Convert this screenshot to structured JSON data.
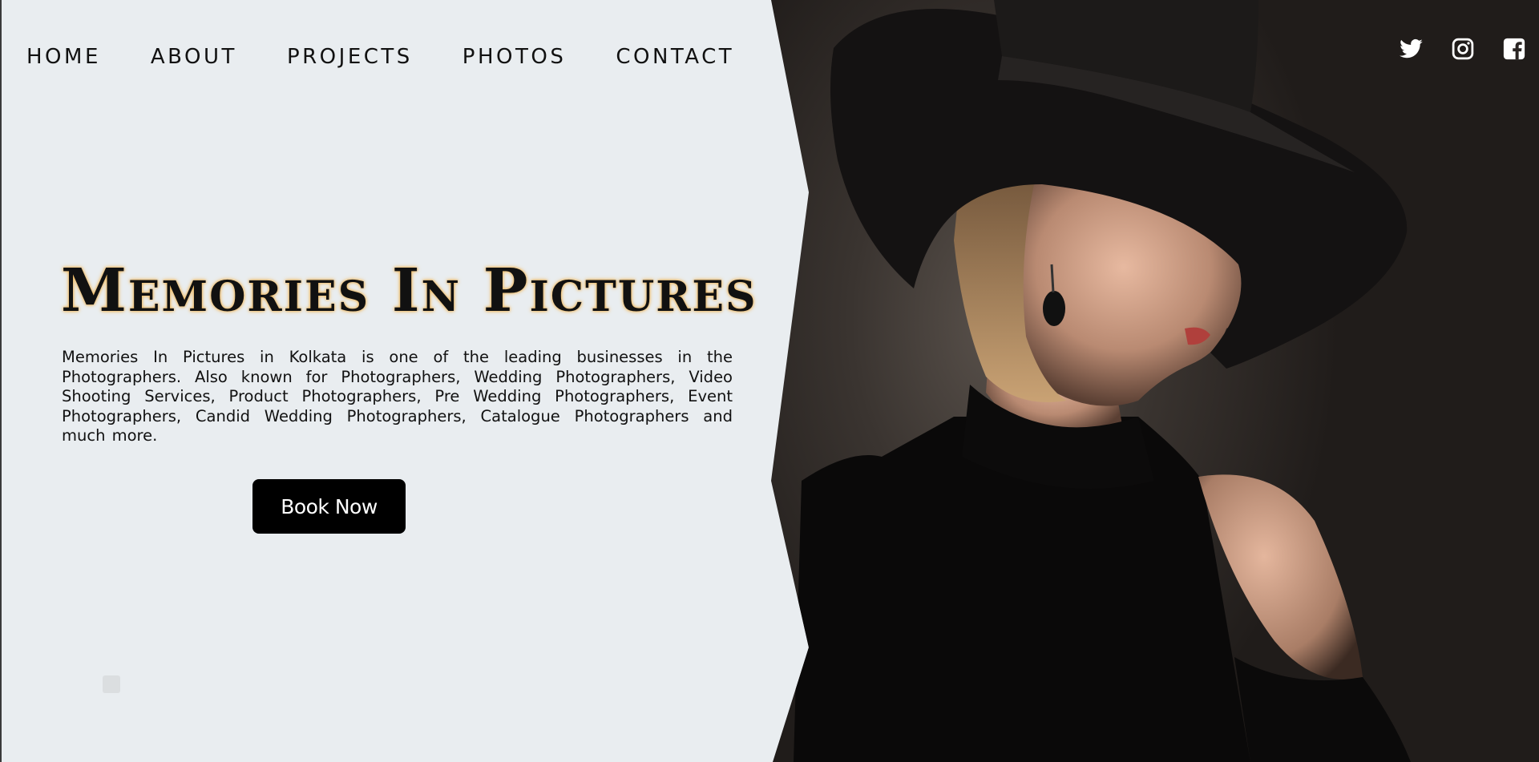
{
  "nav": {
    "items": [
      {
        "label": "HOME"
      },
      {
        "label": "ABOUT"
      },
      {
        "label": "PROJECTS"
      },
      {
        "label": "PHOTOS"
      },
      {
        "label": "CONTACT"
      }
    ]
  },
  "social": {
    "icons": [
      "twitter-icon",
      "instagram-icon",
      "facebook-icon"
    ]
  },
  "hero": {
    "title": "Memories In Pictures",
    "description": "Memories In Pictures in Kolkata is one of the leading businesses in the Photographers. Also known for Photographers, Wedding Photographers, Video Shooting Services, Product Photographers, Pre Wedding Photographers, Event Photographers, Candid Wedding Photographers, Catalogue Photographers and much more.",
    "cta_label": "Book Now",
    "photo_subject": "woman in black wide-brim hat, profile"
  },
  "colors": {
    "background": "#e9edf0",
    "text": "#111111",
    "button": "#000000",
    "title_glow": "#f5c26b"
  }
}
